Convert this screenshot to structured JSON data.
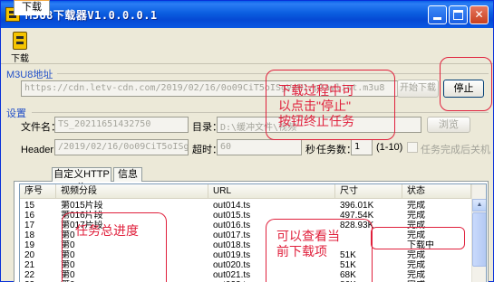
{
  "window": {
    "title": "M3U8下载器V1.0.0.0.1",
    "buttons": {
      "minimize": "",
      "maximize": "",
      "close": "✕"
    }
  },
  "toolbar": {
    "download_label": "下载"
  },
  "m3u8": {
    "section_label": "M3U8地址",
    "url_value": "https://cdn.letv-cdn.com/2019/02/16/0o09CiT5oISgVuW1/playlist.m3u8",
    "start_button": "开始下载",
    "stop_button": "停止"
  },
  "settings": {
    "section_label": "设置",
    "filename_label": "文件名：",
    "filename_value": "TS_20211651432750",
    "directory_label": "目录：",
    "directory_value": "D:\\缓冲文件\\视频",
    "browse_button": "浏览",
    "header_label": "Header：",
    "header_value": "/2019/02/16/0o09CiT5oISgVuW1/",
    "timeout_label": "超时：",
    "timeout_value": "60",
    "seconds_label": "秒",
    "tasks_label": "任务数：",
    "tasks_value": "1",
    "tasks_range": "(1-10)",
    "shutdown_label": "任务完成后关机"
  },
  "tabs": [
    {
      "label": "下载"
    },
    {
      "label": "自定义HTTP头"
    },
    {
      "label": "信息"
    }
  ],
  "table": {
    "columns": [
      "序号",
      "视频分段",
      "URL",
      "尺寸",
      "状态"
    ],
    "rows": [
      {
        "index": "15",
        "segment": "第015片段",
        "url": "out014.ts",
        "size": "396.01K",
        "status": "完成"
      },
      {
        "index": "16",
        "segment": "第016片段",
        "url": "out015.ts",
        "size": "497.54K",
        "status": "完成"
      },
      {
        "index": "17",
        "segment": "第017片段",
        "url": "out016.ts",
        "size": "828.93K",
        "status": "完成"
      },
      {
        "index": "18",
        "segment": "第0",
        "url": "out017.ts",
        "size": "",
        "status": "完成"
      },
      {
        "index": "19",
        "segment": "第0",
        "url": "out018.ts",
        "size": "",
        "status": "下载中"
      },
      {
        "index": "20",
        "segment": "第0",
        "url": "out019.ts",
        "size": "51K",
        "status": "完成"
      },
      {
        "index": "21",
        "segment": "第0",
        "url": "out020.ts",
        "size": "51K",
        "status": "完成"
      },
      {
        "index": "22",
        "segment": "第0",
        "url": "out021.ts",
        "size": "68K",
        "status": "完成"
      },
      {
        "index": "23",
        "segment": "第0",
        "url": "out022.ts",
        "size": "86K",
        "status": "完成"
      }
    ]
  },
  "annotations": {
    "stop_note_line1": "下载过程中可",
    "stop_note_line2": "以点击\"停止\"",
    "stop_note_line3": "按钮终止任务",
    "progress_note": "任务总进度",
    "current_note_line1": "可以查看当",
    "current_note_line2": "前下载项"
  },
  "colors": {
    "titlebar": "#0a58e2",
    "annotation": "#e0203c",
    "section_label": "#2250c8"
  }
}
